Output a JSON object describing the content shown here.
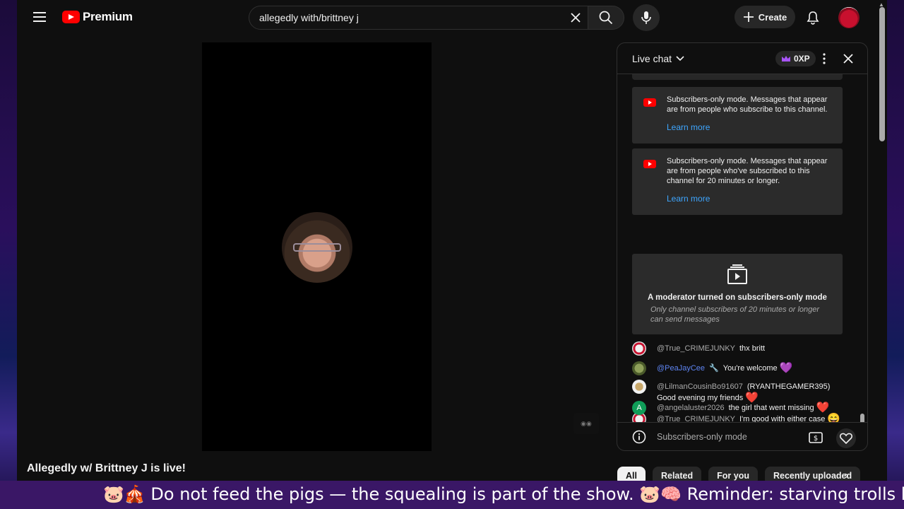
{
  "masthead": {
    "logo_text": "Premium",
    "search_value": "allegedly with/brittney j",
    "create_label": "Create"
  },
  "video": {
    "title": "Allegedly w/ Brittney J is live!"
  },
  "chat": {
    "title": "Live chat",
    "xp_label": "0XP",
    "notices": [
      {
        "text": "Subscribers-only mode. Messages that appear are from people who subscribe to this channel.",
        "link": "Learn more"
      },
      {
        "text": "Subscribers-only mode. Messages that appear are from people who've subscribed to this channel for 20 minutes or longer.",
        "link": "Learn more"
      }
    ],
    "moderator_notice": {
      "title": "A moderator turned on subscribers-only mode",
      "subtitle": "Only channel subscribers of 20 minutes or longer can send messages"
    },
    "messages": [
      {
        "user": "@True_CRIMEJUNKY",
        "text": "thx britt"
      },
      {
        "user": "@PeaJayCee",
        "text": "You're welcome"
      },
      {
        "user": "@LilmanCousinBo91607",
        "text": "(RYANTHEGAMER395) Good evening my friends"
      },
      {
        "user": "@True_CRIMEJUNKY",
        "text": "I'm good with either case"
      },
      {
        "user": "@angelaluster2026",
        "text": "the girl that went missing"
      }
    ],
    "avatar_initial_5": "A",
    "footer_text": "Subscribers-only mode"
  },
  "chips": [
    "All",
    "Related",
    "For you",
    "Recently uploaded"
  ],
  "ticker": {
    "text": "🐷🎪 Do not feed the pigs — the squealing is part of the show. 🐷🧠 Reminder: starving trolls bu"
  },
  "colors": {
    "accent_red": "#ff0000",
    "link_blue": "#3ea6ff",
    "ticker_bg": "#3a1766"
  }
}
